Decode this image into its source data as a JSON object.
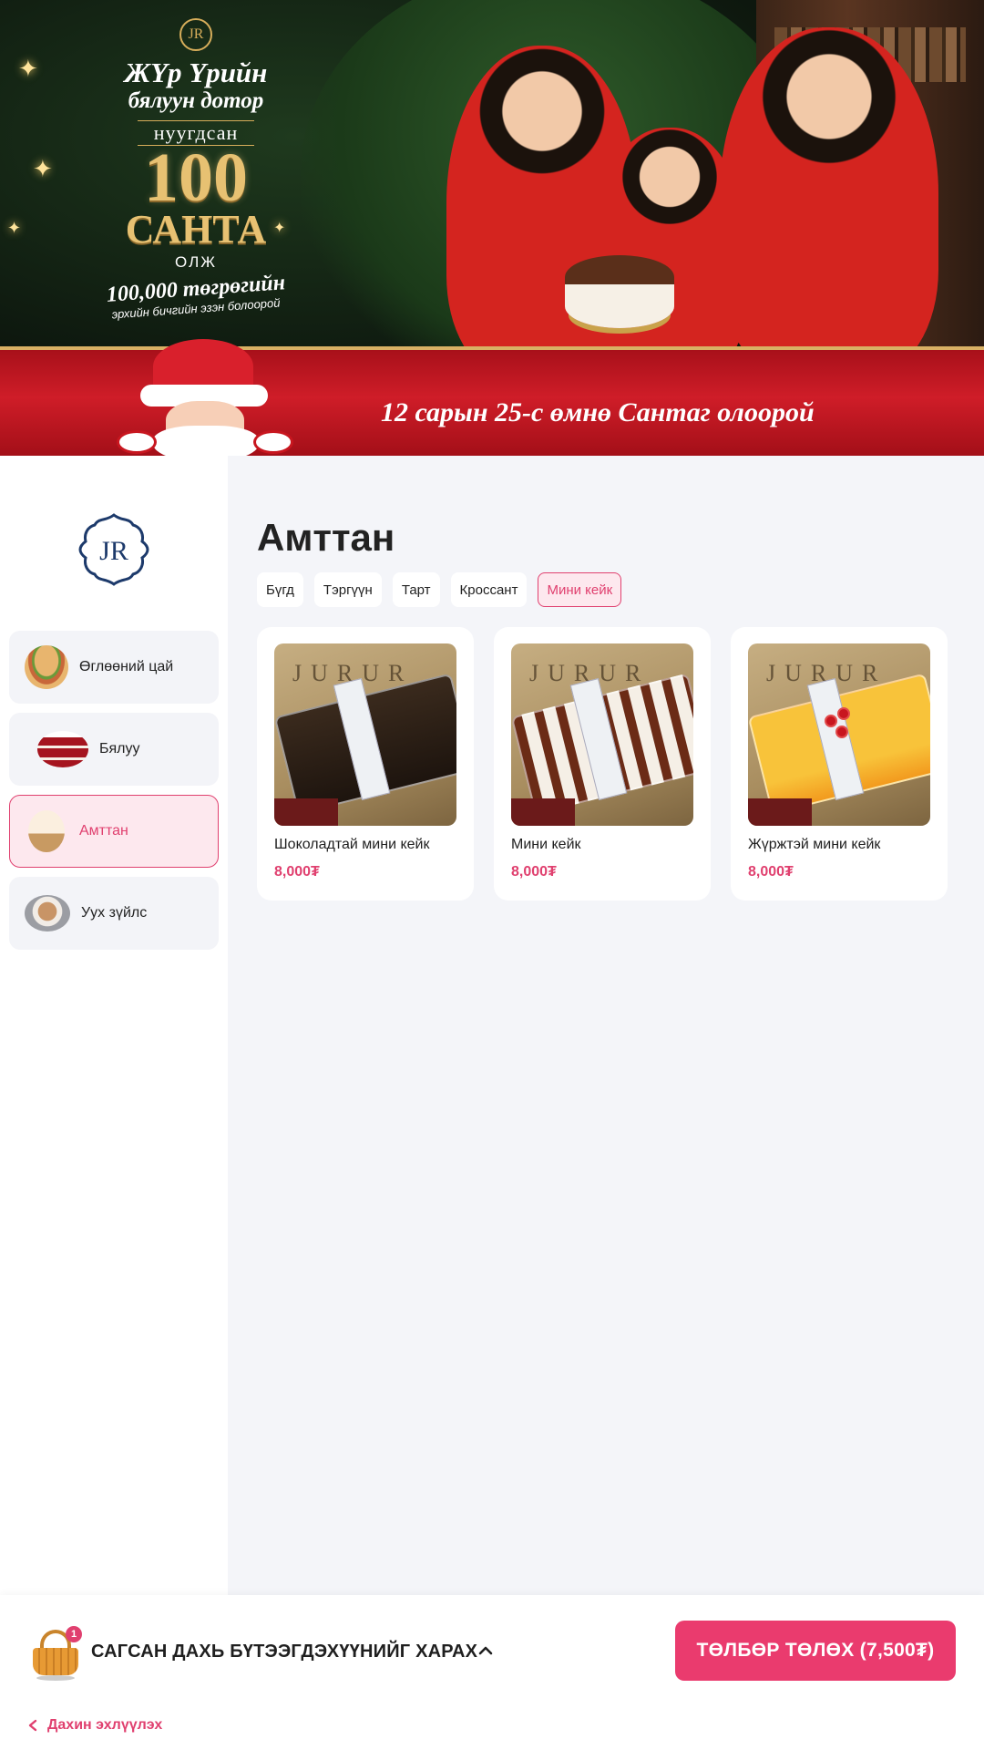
{
  "banner": {
    "logo_text": "JR",
    "headline_1": "ЖҮр Үрийн",
    "headline_2": "бялуун дотор",
    "headline_3": "нуугдсан",
    "headline_big": "100",
    "headline_santa": "САНТА",
    "headline_olj": "ОЛЖ",
    "headline_money": "100,000 төгрөгийн",
    "headline_sub": "эрхийн бичгийн эзэн болоорой",
    "ribbon_text": "12 сарын 25-с өмнө Сантаг олоорой"
  },
  "sidebar": {
    "logo_text": "JR",
    "categories": [
      {
        "label": "Өглөөний цай",
        "icon": "sandwich"
      },
      {
        "label": "Бялуу",
        "icon": "cake-slice"
      },
      {
        "label": "Амттан",
        "icon": "cupcake",
        "active": true
      },
      {
        "label": "Ууx зүйлс",
        "icon": "coffee-cup"
      }
    ]
  },
  "main": {
    "title": "Амттан",
    "filters": [
      {
        "label": "Бүгд"
      },
      {
        "label": "Тэргүүн"
      },
      {
        "label": "Тарт"
      },
      {
        "label": "Кроссант"
      },
      {
        "label": "Мини кейк",
        "active": true
      }
    ],
    "products": [
      {
        "name": "Шоколадтай мини кейк",
        "price": "8,000₮",
        "image_text": "JURUR"
      },
      {
        "name": "Мини кейк",
        "price": "8,000₮",
        "image_text": "JURUR"
      },
      {
        "name": "Жүржтэй мини кейк",
        "price": "8,000₮",
        "image_text": "JURUR"
      }
    ]
  },
  "cart": {
    "badge_count": "1",
    "label": "САГСАН ДАХЬ БҮТЭЭГДЭХҮҮНИЙГ ХАРАХ",
    "pay_label": "ТӨЛБӨР ТӨЛӨХ (7,500₮)",
    "reorder_label": "Дахин эхлүүлэх"
  },
  "colors": {
    "accent": "#e0406f",
    "pay_button": "#ea3b6e",
    "logo_navy": "#1d3a6b",
    "page_bg": "#f4f5f9"
  }
}
